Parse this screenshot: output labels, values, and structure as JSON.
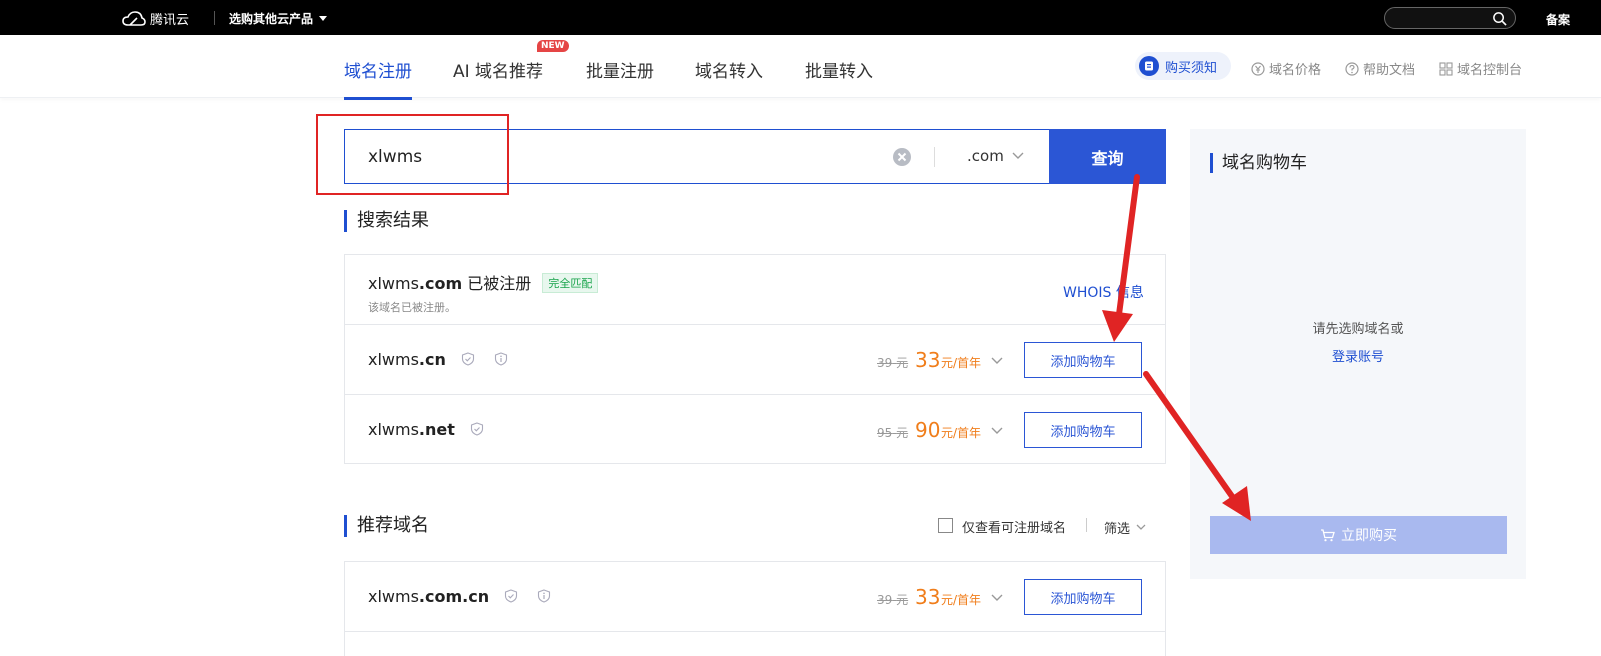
{
  "topbar": {
    "brand": "腾讯云",
    "product_select": "选购其他云产品",
    "right_link": "备案"
  },
  "nav": {
    "tabs": [
      {
        "label": "域名注册",
        "active": true
      },
      {
        "label": "AI 域名推荐"
      },
      {
        "label": "批量注册"
      },
      {
        "label": "域名转入"
      },
      {
        "label": "批量转入"
      }
    ],
    "new_badge": "NEW",
    "buy_tip": "购买须知",
    "links": [
      {
        "label": "域名价格",
        "icon": "yen-circle-icon"
      },
      {
        "label": "帮助文档",
        "icon": "help-circle-icon"
      },
      {
        "label": "域名控制台",
        "icon": "grid-icon"
      }
    ]
  },
  "search": {
    "value": "xlwms",
    "tld": ".com",
    "query_button": "查询"
  },
  "results": {
    "heading": "搜索结果",
    "registered": {
      "name": "xlwms",
      "tld": ".com",
      "status": "已被注册",
      "tag": "完全匹配",
      "note": "该域名已被注册。",
      "whois": "WHOIS 信息"
    },
    "available": [
      {
        "name": "xlwms",
        "tld": ".cn",
        "old_price": "39",
        "price": "33",
        "unit": "元/首年",
        "old_unit": "元",
        "add": "添加购物车"
      },
      {
        "name": "xlwms",
        "tld": ".net",
        "old_price": "95",
        "price": "90",
        "unit": "元/首年",
        "old_unit": "元",
        "add": "添加购物车"
      }
    ]
  },
  "recommend": {
    "heading": "推荐域名",
    "filter_checkbox": "仅查看可注册域名",
    "filter_select": "筛选",
    "items": [
      {
        "name": "xlwms",
        "tld": ".com.cn",
        "old_price": "39",
        "price": "33",
        "unit": "元/首年",
        "old_unit": "元",
        "add": "添加购物车"
      }
    ]
  },
  "cart": {
    "title": "域名购物车",
    "empty_text": "请先选购域名或",
    "login_link": "登录账号",
    "buy_button": "立即购买"
  },
  "colors": {
    "accent": "#1f4fd1",
    "price": "#f07d1a",
    "annotation": "#e02424"
  }
}
